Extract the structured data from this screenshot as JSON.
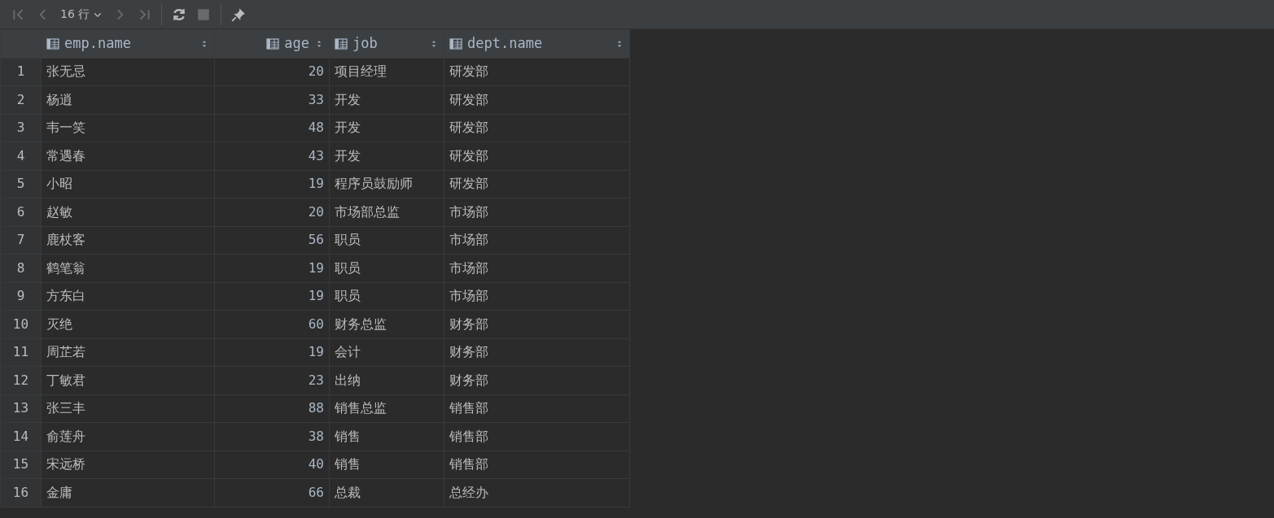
{
  "toolbar": {
    "buttons": [
      {
        "kind": "first",
        "disabled": true
      },
      {
        "kind": "prev",
        "disabled": true
      },
      {
        "kind": "rows",
        "label": "16 行",
        "disabled": false
      },
      {
        "kind": "next",
        "disabled": true
      },
      {
        "kind": "last",
        "disabled": true
      },
      {
        "kind": "sep"
      },
      {
        "kind": "refresh",
        "disabled": false
      },
      {
        "kind": "stop",
        "disabled": true
      },
      {
        "kind": "sep"
      },
      {
        "kind": "pin",
        "disabled": false
      }
    ]
  },
  "table": {
    "columns": [
      {
        "label": "emp.name",
        "kind": "text"
      },
      {
        "label": "age",
        "kind": "number"
      },
      {
        "label": "job",
        "kind": "text"
      },
      {
        "label": "dept.name",
        "kind": "text"
      }
    ],
    "rows": [
      {
        "number": "1",
        "cells": [
          "张无忌",
          "20",
          "项目经理",
          "研发部"
        ]
      },
      {
        "number": "2",
        "cells": [
          "杨逍",
          "33",
          "开发",
          "研发部"
        ]
      },
      {
        "number": "3",
        "cells": [
          "韦一笑",
          "48",
          "开发",
          "研发部"
        ]
      },
      {
        "number": "4",
        "cells": [
          "常遇春",
          "43",
          "开发",
          "研发部"
        ]
      },
      {
        "number": "5",
        "cells": [
          "小昭",
          "19",
          "程序员鼓励师",
          "研发部"
        ]
      },
      {
        "number": "6",
        "cells": [
          "赵敏",
          "20",
          "市场部总监",
          "市场部"
        ]
      },
      {
        "number": "7",
        "cells": [
          "鹿杖客",
          "56",
          "职员",
          "市场部"
        ]
      },
      {
        "number": "8",
        "cells": [
          "鹤笔翁",
          "19",
          "职员",
          "市场部"
        ]
      },
      {
        "number": "9",
        "cells": [
          "方东白",
          "19",
          "职员",
          "市场部"
        ]
      },
      {
        "number": "10",
        "cells": [
          "灭绝",
          "60",
          "财务总监",
          "财务部"
        ]
      },
      {
        "number": "11",
        "cells": [
          "周芷若",
          "19",
          "会计",
          "财务部"
        ]
      },
      {
        "number": "12",
        "cells": [
          "丁敏君",
          "23",
          "出纳",
          "财务部"
        ]
      },
      {
        "number": "13",
        "cells": [
          "张三丰",
          "88",
          "销售总监",
          "销售部"
        ]
      },
      {
        "number": "14",
        "cells": [
          "俞莲舟",
          "38",
          "销售",
          "销售部"
        ]
      },
      {
        "number": "15",
        "cells": [
          "宋远桥",
          "40",
          "销售",
          "销售部"
        ]
      },
      {
        "number": "16",
        "cells": [
          "金庸",
          "66",
          "总裁",
          "总经办"
        ]
      }
    ]
  }
}
